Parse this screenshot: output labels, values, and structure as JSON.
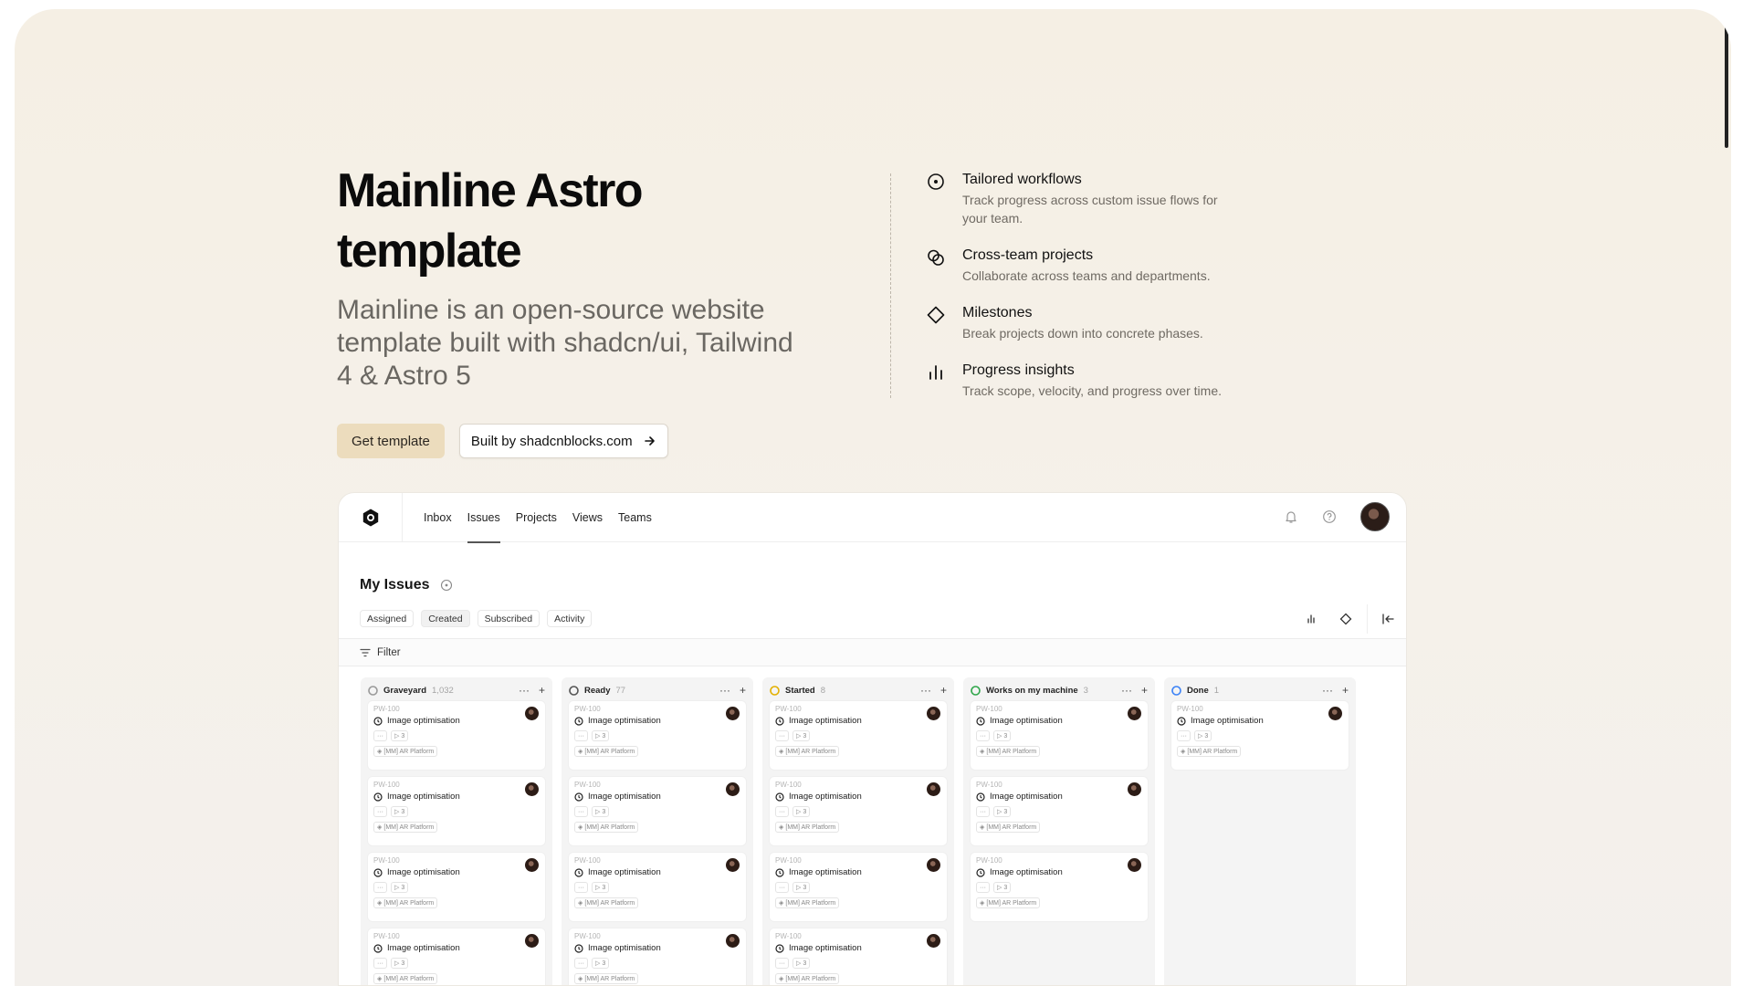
{
  "hero": {
    "title": "Mainline Astro template",
    "subtitle": "Mainline is an open-source website template built with shadcn/ui, Tailwind 4 & Astro 5",
    "primary_button": "Get template",
    "secondary_button": "Built by shadcnblocks.com"
  },
  "features": [
    {
      "icon": "circle-dot-icon",
      "title": "Tailored workflows",
      "desc": "Track progress across custom issue flows for your team."
    },
    {
      "icon": "blend-icon",
      "title": "Cross-team projects",
      "desc": "Collaborate across teams and departments."
    },
    {
      "icon": "diamond-icon",
      "title": "Milestones",
      "desc": "Break projects down into concrete phases."
    },
    {
      "icon": "bar-chart-icon",
      "title": "Progress insights",
      "desc": "Track scope, velocity, and progress over time."
    }
  ],
  "app": {
    "nav": [
      "Inbox",
      "Issues",
      "Projects",
      "Views",
      "Teams"
    ],
    "active_nav": "Issues",
    "page_title": "My Issues",
    "tabs": [
      "Assigned",
      "Created",
      "Subscribed",
      "Activity"
    ],
    "selected_tab": "Created",
    "filter_label": "Filter",
    "columns": [
      {
        "name": "Graveyard",
        "count": "1,032",
        "status_color": "#9a9a9a"
      },
      {
        "name": "Ready",
        "count": "77",
        "status_color": "#555555"
      },
      {
        "name": "Started",
        "count": "8",
        "status_color": "#e3b000"
      },
      {
        "name": "Works on my machine",
        "count": "3",
        "status_color": "#2fa64a"
      },
      {
        "name": "Done",
        "count": "1",
        "status_color": "#3b82f6"
      }
    ],
    "card": {
      "id": "PW-100",
      "title": "Image optimisation",
      "sub_count": "3",
      "project": "[MM] AR Platform"
    }
  }
}
